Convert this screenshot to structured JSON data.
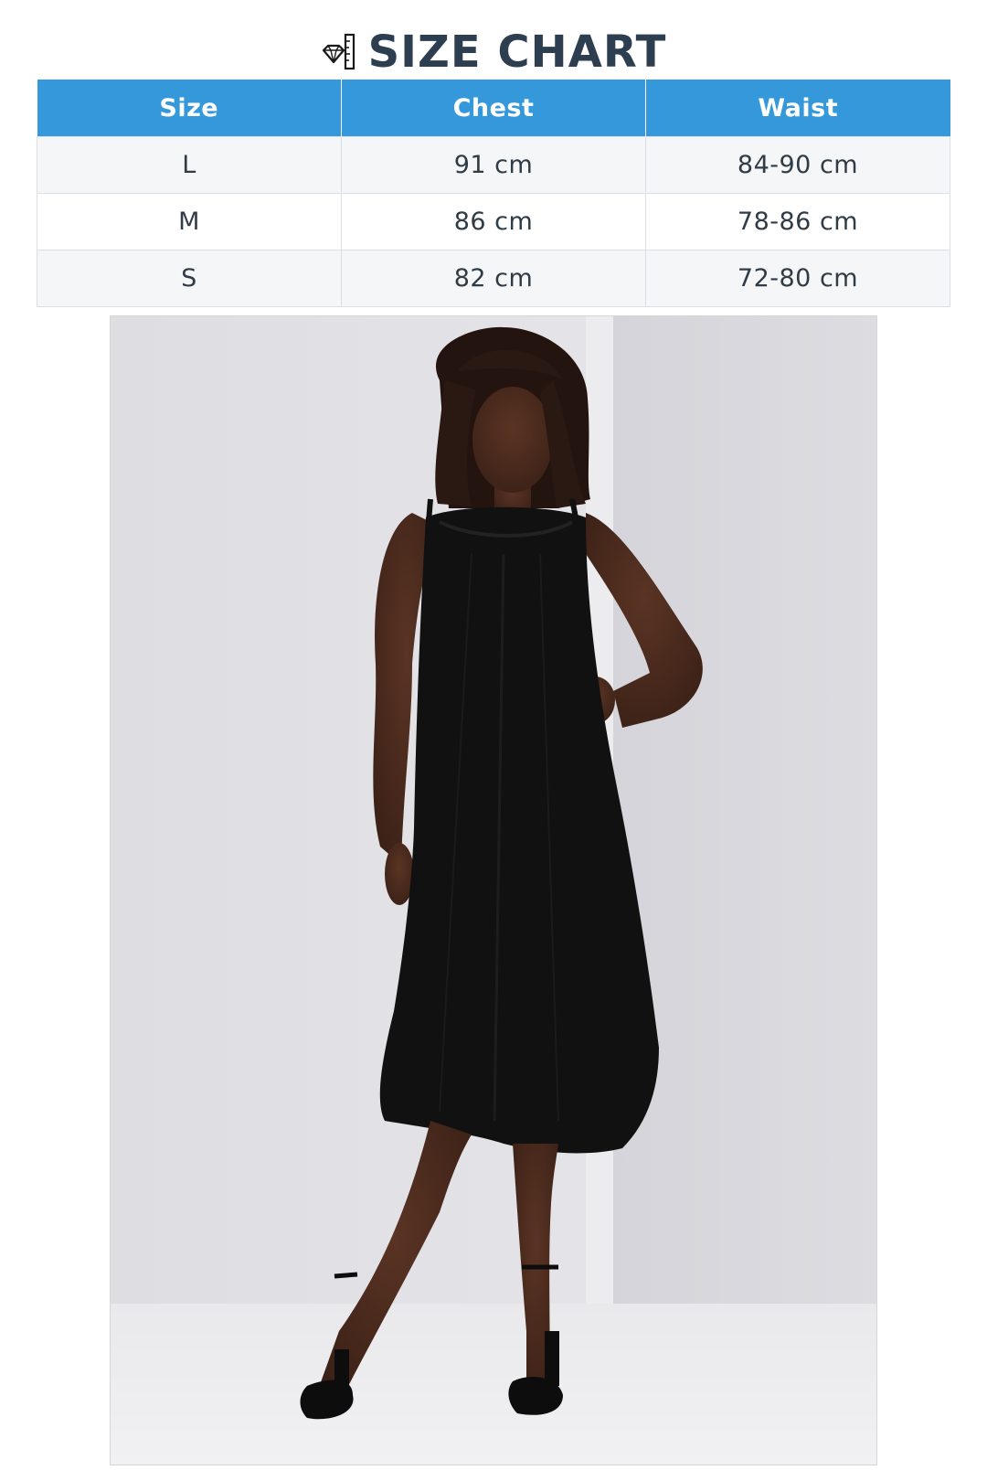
{
  "title": "SIZE CHART",
  "title_icon": "ruler-diamond-icon",
  "table": {
    "headers": [
      "Size",
      "Chest",
      "Waist"
    ],
    "rows": [
      {
        "size": "L",
        "chest": "91 cm",
        "waist": "84-90 cm"
      },
      {
        "size": "M",
        "chest": "86 cm",
        "waist": "78-86 cm"
      },
      {
        "size": "S",
        "chest": "82 cm",
        "waist": "72-80 cm"
      }
    ]
  },
  "colors": {
    "header_bg": "#3498db",
    "title": "#2c3e50",
    "row_alt": "#f5f6f7"
  }
}
